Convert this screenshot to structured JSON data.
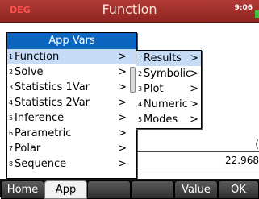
{
  "title_bar": {
    "mode_indicator": "DEG",
    "title": "Function",
    "clock": "9:06"
  },
  "background": {
    "value_1": "(",
    "value_2": "22.968"
  },
  "app_vars_menu": {
    "header": "App Vars",
    "items": [
      {
        "num": "1",
        "label": "Function",
        "arrow": ">"
      },
      {
        "num": "2",
        "label": "Solve",
        "arrow": ">"
      },
      {
        "num": "3",
        "label": "Statistics 1Var",
        "arrow": ">"
      },
      {
        "num": "4",
        "label": "Statistics 2Var",
        "arrow": ">"
      },
      {
        "num": "5",
        "label": "Inference",
        "arrow": ">"
      },
      {
        "num": "6",
        "label": "Parametric",
        "arrow": ">"
      },
      {
        "num": "7",
        "label": "Polar",
        "arrow": ">"
      },
      {
        "num": "8",
        "label": "Sequence",
        "arrow": ">"
      }
    ],
    "selected": "Function"
  },
  "submenu": {
    "items": [
      {
        "num": "1",
        "label": "Results",
        "arrow": ">"
      },
      {
        "num": "2",
        "label": "Symbolic",
        "arrow": ">"
      },
      {
        "num": "3",
        "label": "Plot",
        "arrow": ">"
      },
      {
        "num": "4",
        "label": "Numeric",
        "arrow": ">"
      },
      {
        "num": "5",
        "label": "Modes",
        "arrow": ">"
      }
    ],
    "selected": "Results"
  },
  "softkeys": {
    "home": "Home",
    "app": "App",
    "blank1": "",
    "blank2": "",
    "value": "Value",
    "ok": "OK"
  }
}
